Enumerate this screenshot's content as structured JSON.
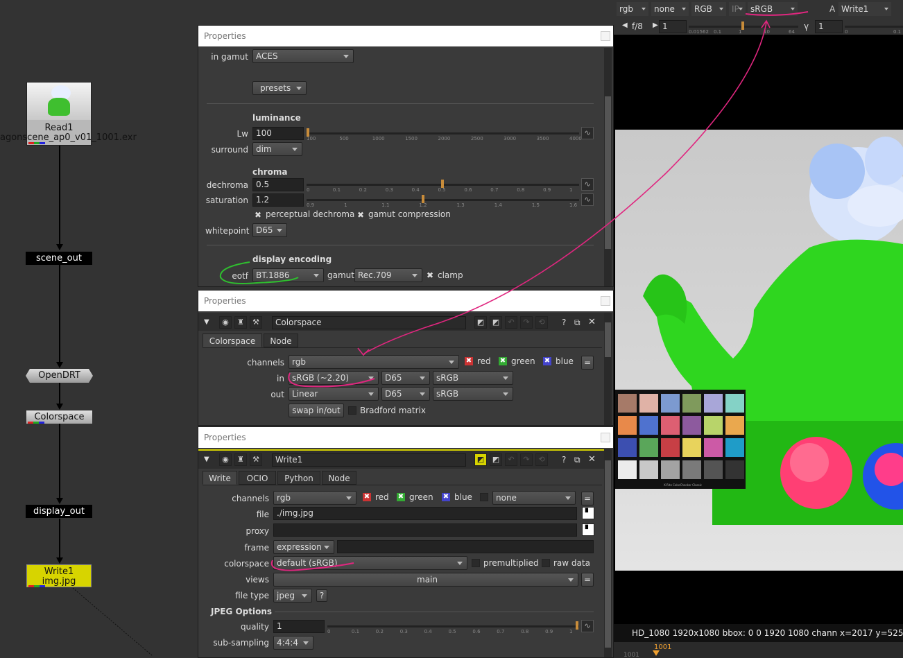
{
  "graph": {
    "read_label": "Read1",
    "read_file": "agonscene_ap0_v01_1001.exr",
    "scene_out": "scene_out",
    "opendrt": "OpenDRT",
    "colorspace": "Colorspace",
    "display_out": "display_out",
    "write_label": "Write1",
    "write_file": "img.jpg"
  },
  "panel1": {
    "title": "Properties",
    "in_gamut_label": "in gamut",
    "in_gamut": "ACES",
    "presets": "presets",
    "luminance_header": "luminance",
    "lw_label": "Lw",
    "lw_value": "100",
    "lw_ticks": [
      "100",
      "500",
      "1000",
      "1500",
      "2000",
      "2500",
      "3000",
      "3500",
      "4000"
    ],
    "surround_label": "surround",
    "surround": "dim",
    "chroma_header": "chroma",
    "dechroma_label": "dechroma",
    "dechroma_value": "0.5",
    "dechroma_ticks": [
      "0",
      "0.1",
      "0.2",
      "0.3",
      "0.4",
      "0.5",
      "0.6",
      "0.7",
      "0.8",
      "0.9",
      "1"
    ],
    "saturation_label": "saturation",
    "saturation_value": "1.2",
    "saturation_ticks": [
      "0.9",
      "1",
      "1.1",
      "1.2",
      "1.3",
      "1.4",
      "1.5",
      "1.6"
    ],
    "perceptual_dechroma": "perceptual dechroma",
    "gamut_compression": "gamut compression",
    "whitepoint_label": "whitepoint",
    "whitepoint": "D65",
    "display_header": "display encoding",
    "eotf_label": "eotf",
    "eotf": "BT.1886",
    "gamut_label": "gamut",
    "gamut": "Rec.709",
    "clamp": "clamp"
  },
  "panel2": {
    "title": "Properties",
    "node_name": "Colorspace",
    "tabs": [
      "Colorspace",
      "Node"
    ],
    "channels_label": "channels",
    "channels": "rgb",
    "red": "red",
    "green": "green",
    "blue": "blue",
    "in_label": "in",
    "in_space": "sRGB (~2.20)",
    "in_white": "D65",
    "in_prim": "sRGB",
    "out_label": "out",
    "out_space": "Linear",
    "out_white": "D65",
    "out_prim": "sRGB",
    "swap": "swap in/out",
    "bradford": "Bradford matrix",
    "eq": "="
  },
  "panel3": {
    "title": "Properties",
    "node_name": "Write1",
    "tabs": [
      "Write",
      "OCIO",
      "Python",
      "Node"
    ],
    "channels_label": "channels",
    "channels": "rgb",
    "red": "red",
    "green": "green",
    "blue": "blue",
    "none": "none",
    "file_label": "file",
    "file": "./img.jpg",
    "proxy_label": "proxy",
    "frame_label": "frame",
    "frame": "expression",
    "colorspace_label": "colorspace",
    "colorspace": "default (sRGB)",
    "premultiplied": "premultiplied",
    "raw_data": "raw data",
    "views_label": "views",
    "views": "main",
    "filetype_label": "file type",
    "filetype": "jpeg",
    "help": "?",
    "jpeg_header": "JPEG Options",
    "quality_label": "quality",
    "quality_value": "1",
    "quality_ticks": [
      "0",
      "0.1",
      "0.2",
      "0.3",
      "0.4",
      "0.5",
      "0.6",
      "0.7",
      "0.8",
      "0.9",
      "1"
    ],
    "subsampling_label": "sub-sampling",
    "subsampling": "4:4:4",
    "eq": "="
  },
  "viewer": {
    "channels": "rgb",
    "alpha": "none",
    "rgb_mode": "RGB",
    "ip": "IP",
    "display": "sRGB",
    "input_a": "A",
    "input_node": "Write1",
    "fstop": "f/8",
    "gain": "1",
    "gain_ticks": [
      "0.01562",
      "0.1",
      "1",
      "10",
      "64"
    ],
    "gamma_label": "γ",
    "gamma": "1",
    "gamma_ticks": [
      "0",
      "0.1"
    ],
    "status": "HD_1080 1920x1080  bbox: 0 0 1920 1080 chann  x=2017 y=525",
    "frame": "1001",
    "timeline_frame": "1001",
    "checker_caption": "X-Rite ColorChecker Classic"
  },
  "colors": {
    "accent_orange": "#c88c3a",
    "write_yellow": "#d7d400",
    "annotation_pink": "#e0267f",
    "annotation_green": "#2fbf2f"
  }
}
